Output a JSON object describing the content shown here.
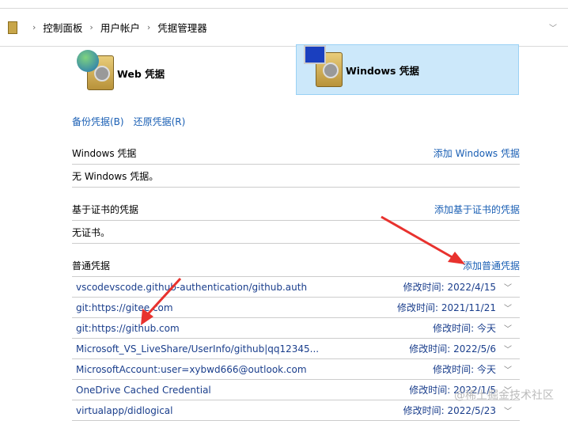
{
  "breadcrumb": [
    "控制面板",
    "用户帐户",
    "凭据管理器"
  ],
  "tiles": {
    "web": "Web 凭据",
    "windows": "Windows 凭据"
  },
  "links": {
    "backup": "备份凭据(B)",
    "restore": "还原凭据(R)"
  },
  "sections": [
    {
      "title": "Windows 凭据",
      "action": "添加 Windows 凭据",
      "body": "无 Windows 凭据。"
    },
    {
      "title": "基于证书的凭据",
      "action": "添加基于证书的凭据",
      "body": "无证书。"
    },
    {
      "title": "普通凭据",
      "action": "添加普通凭据"
    }
  ],
  "generic": [
    {
      "name": "vscodevscode.github-authentication/github.auth",
      "modified": "修改时间:  2022/4/15"
    },
    {
      "name": "git:https://gitee.com",
      "modified": "修改时间:  2021/11/21"
    },
    {
      "name": "git:https://github.com",
      "modified": "修改时间:  今天"
    },
    {
      "name": "Microsoft_VS_LiveShare/UserInfo/github|qq12345...",
      "modified": "修改时间:  2022/5/6"
    },
    {
      "name": "MicrosoftAccount:user=xybwd666@outlook.com",
      "modified": "修改时间:  今天"
    },
    {
      "name": "OneDrive Cached Credential",
      "modified": "修改时间:  2022/1/5"
    },
    {
      "name": "virtualapp/didlogical",
      "modified": "修改时间:  2022/5/23"
    }
  ],
  "watermark": "@稀土掘金技术社区",
  "colors": {
    "link": "#1a5fb4",
    "arrow": "#e8322e",
    "selected": "#cce8fa"
  }
}
